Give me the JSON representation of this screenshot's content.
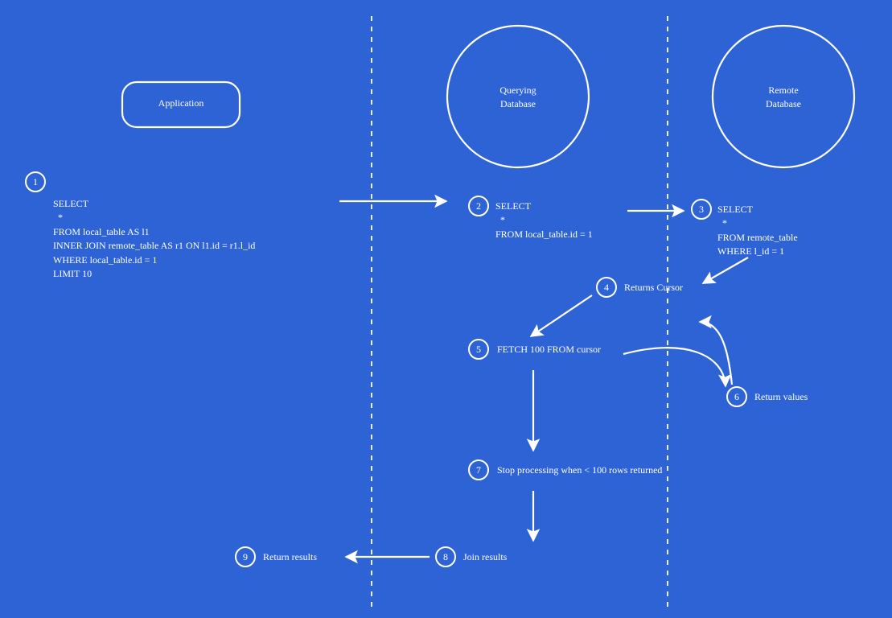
{
  "lanes": {
    "application": "Application",
    "querying": "Querying\nDatabase",
    "remote": "Remote\nDatabase"
  },
  "steps": {
    "s1": {
      "num": "1",
      "text": "SELECT\n  *\nFROM local_table AS l1\nINNER JOIN remote_table AS r1 ON l1.id = r1.l_id\nWHERE local_table.id = 1\nLIMIT 10"
    },
    "s2": {
      "num": "2",
      "text": "SELECT\n  *\nFROM local_table.id = 1"
    },
    "s3": {
      "num": "3",
      "text": "SELECT\n  *\nFROM remote_table\nWHERE l_id = 1"
    },
    "s4": {
      "num": "4",
      "text": "Returns Cursor"
    },
    "s5": {
      "num": "5",
      "text": "FETCH 100 FROM cursor"
    },
    "s6": {
      "num": "6",
      "text": "Return values"
    },
    "s7": {
      "num": "7",
      "text": "Stop processing when < 100 rows returned"
    },
    "s8": {
      "num": "8",
      "text": "Join results"
    },
    "s9": {
      "num": "9",
      "text": "Return results"
    }
  }
}
